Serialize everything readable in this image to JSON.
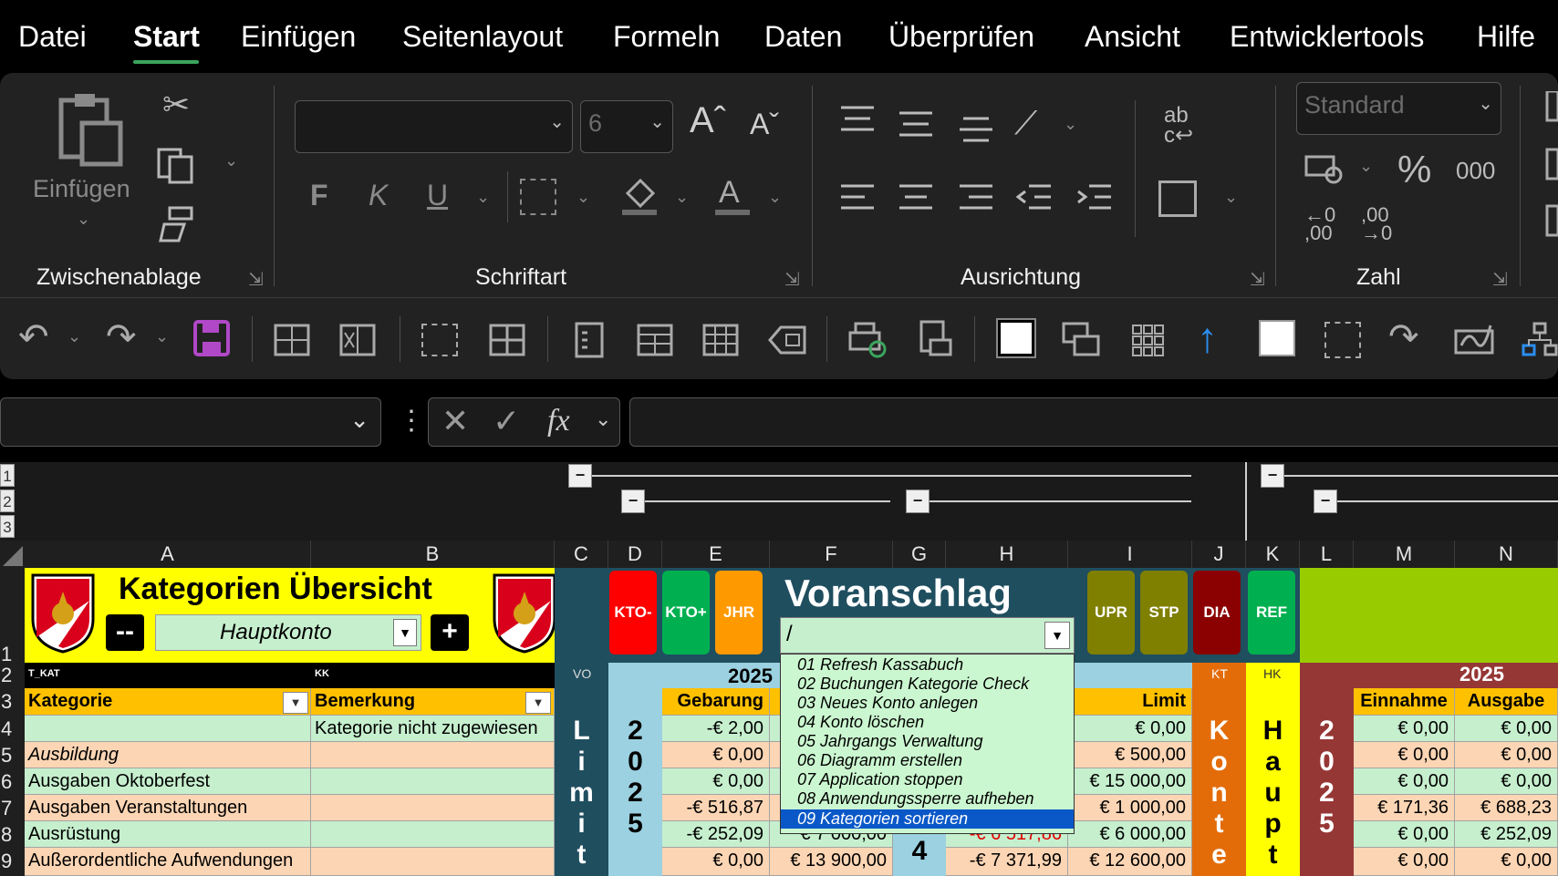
{
  "menu": {
    "items": [
      "Datei",
      "Start",
      "Einfügen",
      "Seitenlayout",
      "Formeln",
      "Daten",
      "Überprüfen",
      "Ansicht",
      "Entwicklertools",
      "Hilfe"
    ],
    "active": "Start",
    "accent": "#3aa55d"
  },
  "ribbon": {
    "clipboard": {
      "paste_label": "Einfügen",
      "group_label": "Zwischenablage"
    },
    "font": {
      "font_name": "",
      "font_size": "6",
      "bold": "F",
      "italic": "K",
      "underline": "U",
      "group_label": "Schriftart"
    },
    "alignment": {
      "group_label": "Ausrichtung"
    },
    "number": {
      "format": "Standard",
      "percent": "%",
      "thousands": "000",
      "group_label": "Zahl"
    }
  },
  "formula_bar": {
    "name_box": "",
    "fx": "fx",
    "formula": ""
  },
  "outline": {
    "levels": [
      "1",
      "2",
      "3"
    ]
  },
  "columns": [
    "A",
    "B",
    "C",
    "D",
    "E",
    "F",
    "G",
    "H",
    "I",
    "J",
    "K",
    "L",
    "M",
    "N"
  ],
  "sheet": {
    "title": "Kategorien Übersicht",
    "account_select": "Hauptkonto",
    "minus_btn": "--",
    "plus_btn": "+",
    "voranschlag": "Voranschlag",
    "voranschlag_select": "/",
    "badges": {
      "kto_minus": "KTO-",
      "kto_plus": "KTO+",
      "jhr": "JHR",
      "upr": "UPR",
      "stp": "STP",
      "dia": "DIA",
      "ref": "REF"
    },
    "row2": {
      "a": "T_KAT",
      "b": "KK",
      "c": "VO",
      "year_left": "2025",
      "j": "KT",
      "k": "HK",
      "year_right": "2025"
    },
    "row3": {
      "a": "Kategorie",
      "b": "Bemerkung",
      "e": "Gebarung",
      "i": "Limit",
      "m": "Einnahme",
      "n": "Ausgabe"
    },
    "rows": [
      {
        "num": "4",
        "a": "",
        "b": "Kategorie nicht zugewiesen",
        "e": "-€ 2,00",
        "f": "",
        "h": "",
        "i": "€ 0,00",
        "m": "€ 0,00",
        "n": "€ 0,00"
      },
      {
        "num": "5",
        "a": "Ausbildung",
        "b": "",
        "e": "€ 0,00",
        "f": "",
        "h": "",
        "i": "€ 500,00",
        "m": "€ 0,00",
        "n": "€ 0,00"
      },
      {
        "num": "6",
        "a": "Ausgaben Oktoberfest",
        "b": "",
        "e": "€ 0,00",
        "f": "",
        "h": "",
        "i": "€ 15 000,00",
        "m": "€ 0,00",
        "n": "€ 0,00"
      },
      {
        "num": "7",
        "a": "Ausgaben Veranstaltungen",
        "b": "",
        "e": "-€ 516,87",
        "f": "",
        "h": "",
        "i": "€ 1 000,00",
        "m": "€ 171,36",
        "n": "€ 688,23"
      },
      {
        "num": "8",
        "a": "Ausrüstung",
        "b": "",
        "e": "-€ 252,09",
        "f": "€ 7 000,00",
        "h": "-€ 6 517,86",
        "i": "€ 6 000,00",
        "m": "€ 0,00",
        "n": "€ 252,09"
      },
      {
        "num": "9",
        "a": "Außerordentliche Aufwendungen",
        "b": "",
        "e": "€ 0,00",
        "f": "€ 13 900,00",
        "h": "-€ 7 371,99",
        "i": "€ 12 600,00",
        "m": "€ 0,00",
        "n": "€ 0,00"
      }
    ],
    "vertical_c": "Limit",
    "vertical_d": "2025",
    "vertical_g": "4",
    "vertical_j": "Konte",
    "vertical_k": "Haupt",
    "vertical_l": "2025"
  },
  "dropdown": {
    "items": [
      "01 Refresh Kassabuch",
      "02 Buchungen Kategorie Check",
      "03 Neues Konto anlegen",
      "04 Konto löschen",
      "05 Jahrgangs Verwaltung",
      "06 Diagramm erstellen",
      "07 Application stoppen",
      "08 Anwendungssperre aufheben",
      "09 Kategorien sortieren"
    ],
    "selected_index": 8
  },
  "colors": {
    "title_bg": "#ffff00",
    "header_orange": "#ffc000",
    "row_green": "#c6efce",
    "row_peach": "#fcd5b4",
    "teal": "#1f4e5f",
    "light_blue": "#9bd1e0",
    "red": "#ff0000",
    "green": "#00b050",
    "olive": "#7f7f00",
    "dark_red": "#8b0000",
    "lime": "#99cc00",
    "brown": "#953735"
  }
}
